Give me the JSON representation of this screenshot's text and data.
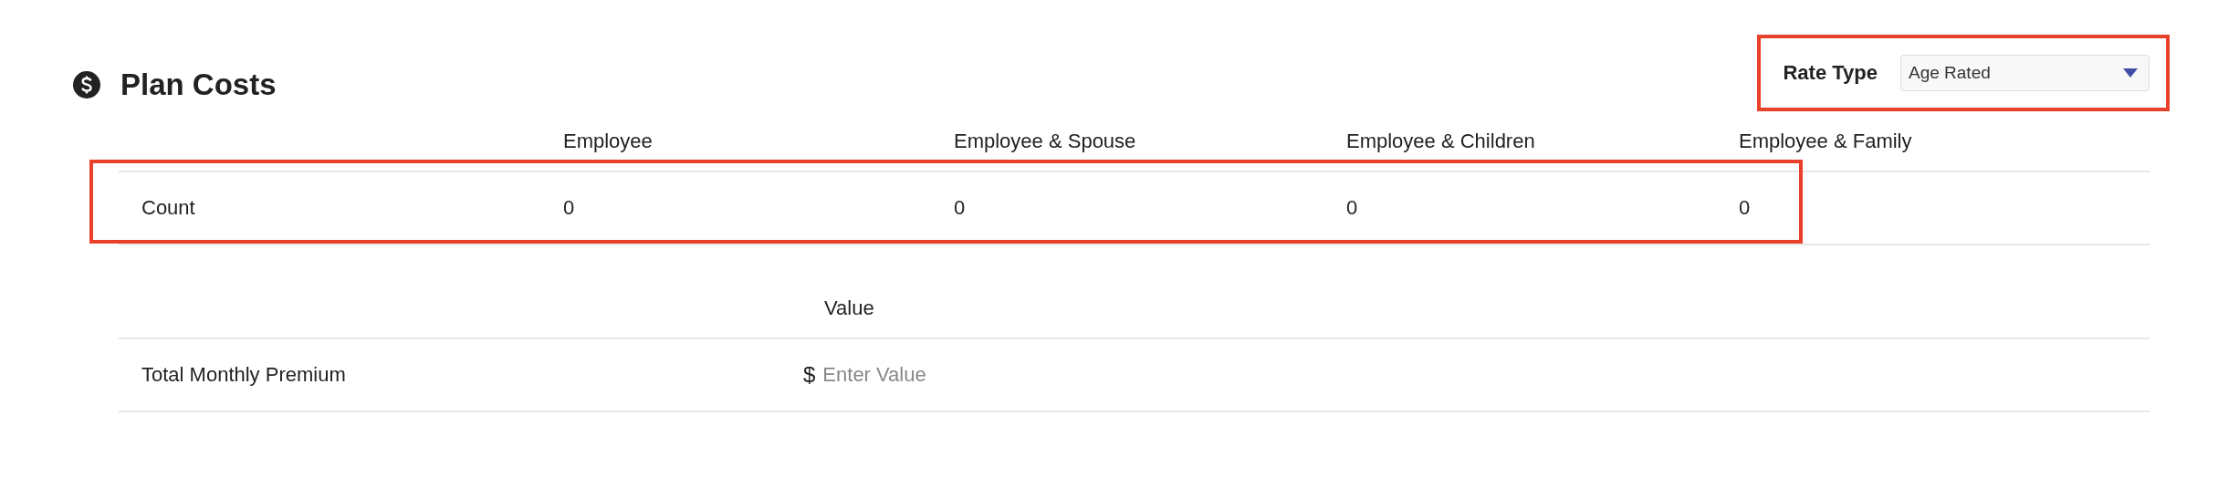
{
  "section": {
    "title": "Plan Costs"
  },
  "rate_type": {
    "label": "Rate Type",
    "value": "Age Rated",
    "highlighted": true
  },
  "count_table": {
    "columns": [
      "Employee",
      "Employee & Spouse",
      "Employee & Children",
      "Employee & Family"
    ],
    "rows": [
      {
        "label": "Count",
        "cells": [
          "0",
          "0",
          "0",
          "0"
        ],
        "highlighted": true
      }
    ]
  },
  "premium_table": {
    "columns": [
      "Value"
    ],
    "rows": [
      {
        "label": "Total Monthly Premium",
        "currency": "$",
        "placeholder": "Enter Value"
      }
    ]
  }
}
